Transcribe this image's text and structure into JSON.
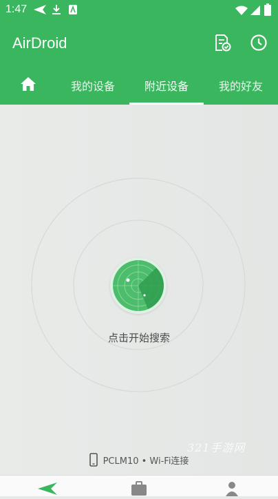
{
  "status_bar": {
    "time": "1:47"
  },
  "app_bar": {
    "title": "AirDroid"
  },
  "tabs": [
    {
      "label": ""
    },
    {
      "label": "我的设备"
    },
    {
      "label": "附近设备"
    },
    {
      "label": "我的好友"
    }
  ],
  "radar": {
    "action_label": "点击开始搜索"
  },
  "device": {
    "text": "PCLM10 • Wi-Fi连接"
  },
  "watermark": "321手游网",
  "colors": {
    "primary_green": "#3ab65e",
    "radar_green": "#4bbd6b"
  }
}
